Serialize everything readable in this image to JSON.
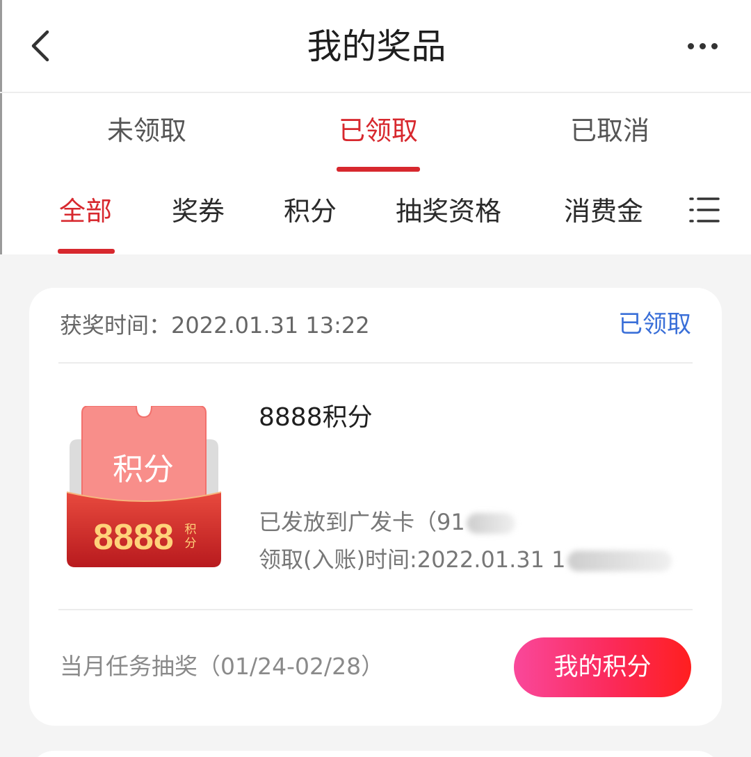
{
  "header": {
    "title": "我的奖品",
    "back_icon": "chevron-left-icon",
    "more_icon": "more-dots-icon"
  },
  "status_tabs": [
    {
      "label": "未领取",
      "active": false
    },
    {
      "label": "已领取",
      "active": true
    },
    {
      "label": "已取消",
      "active": false
    }
  ],
  "category_tabs": [
    {
      "label": "全部",
      "active": true
    },
    {
      "label": "奖券",
      "active": false
    },
    {
      "label": "积分",
      "active": false
    },
    {
      "label": "抽奖资格",
      "active": false
    },
    {
      "label": "消费金",
      "active": false
    }
  ],
  "category_menu_icon": "list-menu-icon",
  "card": {
    "award_time_label": "获奖时间：",
    "award_time": "2022.01.31 13:22",
    "status": "已领取",
    "prize_image": {
      "label": "积分",
      "amount": "8888",
      "unit_line1": "积",
      "unit_line2": "分"
    },
    "prize_name": "8888积分",
    "prize_desc": "已发放到广发卡（91",
    "prize_time": "领取(入账)时间:2022.01.31 1",
    "activity": "当月任务抽奖（01/24-02/28）",
    "button_label": "我的积分"
  },
  "colors": {
    "accent_red": "#d7282e",
    "status_blue": "#3a6fd8",
    "button_gradient_start": "#f9489b",
    "button_gradient_end": "#ff1f1f",
    "background": "#f4f4f4"
  }
}
